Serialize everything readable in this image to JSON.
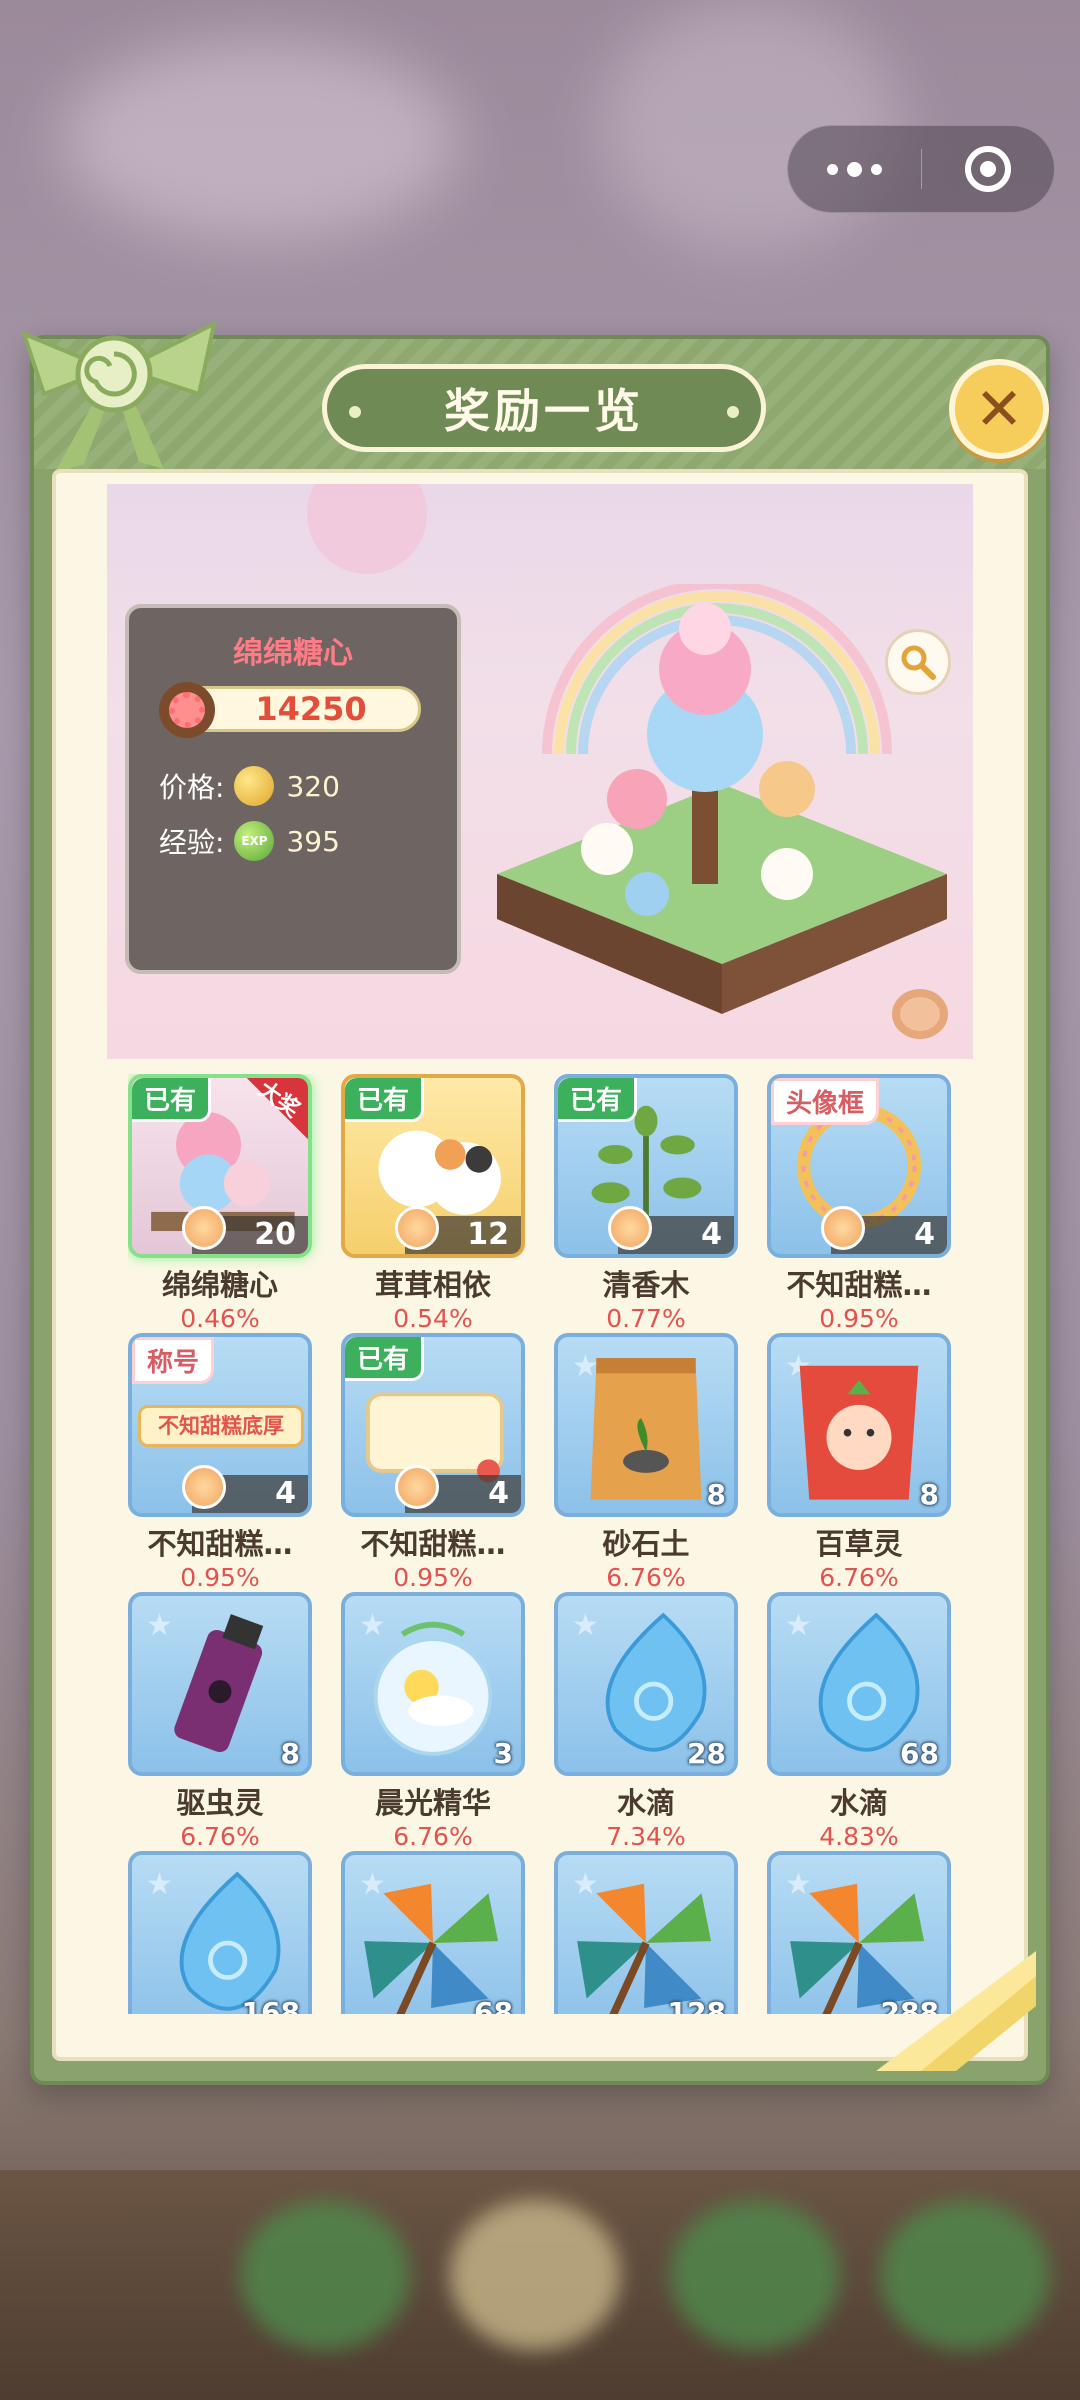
{
  "capsule": {
    "more_icon": "more-dots-icon",
    "close_icon": "target-close-icon"
  },
  "panel": {
    "title": "奖励一览",
    "close_label": "✕"
  },
  "featured": {
    "name": "绵绵糖心",
    "score": "14250",
    "price_label": "价格:",
    "price_value": "320",
    "exp_label": "经验:",
    "exp_value": "395",
    "coin_text": "",
    "exp_text": "EXP"
  },
  "rewards": [
    {
      "name": "绵绵糖心",
      "rate": "0.46%",
      "badge": "已有",
      "qty": "20",
      "style": "bar",
      "banner": "大奖"
    },
    {
      "name": "茸茸相依",
      "rate": "0.54%",
      "badge": "已有",
      "qty": "12",
      "style": "bar"
    },
    {
      "name": "清香木",
      "rate": "0.77%",
      "badge": "已有",
      "qty": "4",
      "style": "bar"
    },
    {
      "name": "不知甜糕…",
      "rate": "0.95%",
      "badge": "头像框",
      "qty": "4",
      "style": "bar"
    },
    {
      "name": "不知甜糕…",
      "rate": "0.95%",
      "badge": "称号",
      "qty": "4",
      "style": "bar",
      "title_text": "不知甜糕底厚"
    },
    {
      "name": "不知甜糕…",
      "rate": "0.95%",
      "badge": "已有",
      "qty": "4",
      "style": "bar"
    },
    {
      "name": "砂石土",
      "rate": "6.76%",
      "qty": "8",
      "style": "plain"
    },
    {
      "name": "百草灵",
      "rate": "6.76%",
      "qty": "8",
      "style": "plain"
    },
    {
      "name": "驱虫灵",
      "rate": "6.76%",
      "qty": "8",
      "style": "plain"
    },
    {
      "name": "晨光精华",
      "rate": "6.76%",
      "qty": "3",
      "style": "plain"
    },
    {
      "name": "水滴",
      "rate": "7.34%",
      "qty": "28",
      "style": "plain"
    },
    {
      "name": "水滴",
      "rate": "4.83%",
      "qty": "68",
      "style": "plain"
    },
    {
      "name": "",
      "rate": "",
      "qty": "168",
      "style": "plain"
    },
    {
      "name": "",
      "rate": "",
      "qty": "68",
      "style": "plain"
    },
    {
      "name": "",
      "rate": "",
      "qty": "128",
      "style": "plain"
    },
    {
      "name": "",
      "rate": "",
      "qty": "288",
      "style": "plain"
    }
  ]
}
